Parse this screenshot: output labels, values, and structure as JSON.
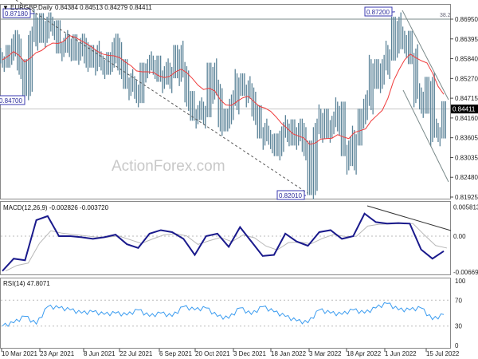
{
  "chart_data": [
    {
      "type": "bar",
      "title": "EURGBP,Daily",
      "ohlc_readout": "0.84384 0.84513 0.84279 0.84411",
      "price_axis_ticks": [
        "0.86950",
        "0.86395",
        "0.85840",
        "0.85270",
        "0.84715",
        "0.84160",
        "0.83605",
        "0.83035",
        "0.82480",
        "0.81925"
      ],
      "ylim": [
        0.8185,
        0.8738
      ],
      "current_price": "0.84411",
      "level_labels": [
        "0.87180",
        "0.84700",
        "0.87200",
        "0.82010"
      ],
      "fib_label": "38.2",
      "fib_level": 0.8695,
      "closes": [
        0.858,
        0.86,
        0.863,
        0.856,
        0.85,
        0.864,
        0.869,
        0.865,
        0.868,
        0.867,
        0.862,
        0.861,
        0.863,
        0.86,
        0.862,
        0.858,
        0.86,
        0.857,
        0.856,
        0.858,
        0.862,
        0.856,
        0.852,
        0.85,
        0.848,
        0.855,
        0.856,
        0.857,
        0.854,
        0.852,
        0.855,
        0.86,
        0.854,
        0.847,
        0.843,
        0.842,
        0.844,
        0.855,
        0.849,
        0.84,
        0.842,
        0.846,
        0.852,
        0.85,
        0.848,
        0.843,
        0.838,
        0.836,
        0.835,
        0.833,
        0.837,
        0.839,
        0.836,
        0.838,
        0.833,
        0.822,
        0.838,
        0.842,
        0.838,
        0.84,
        0.844,
        0.833,
        0.829,
        0.836,
        0.842,
        0.846,
        0.856,
        0.852,
        0.856,
        0.86,
        0.868,
        0.862,
        0.864,
        0.859,
        0.848,
        0.845,
        0.851,
        0.837,
        0.838,
        0.8441
      ],
      "colors": {
        "bars": "#5b8398",
        "ma": "#f03c3c",
        "trend": "#555555",
        "frame": "#888888"
      },
      "watermark": "ActionForex.com"
    },
    {
      "type": "line",
      "title": "MACD(12,26,9) -0.002826 -0.003720",
      "axis_ticks": [
        "0.005813",
        "0.00",
        "-0.006699"
      ],
      "ylim": [
        -0.0077,
        0.0066
      ],
      "macd": [
        -0.0065,
        -0.0042,
        -0.0045,
        0.0032,
        0.004,
        0.0,
        0.0,
        -0.0002,
        -0.0005,
        -0.0002,
        0.0003,
        -0.0015,
        -0.0022,
        0.0005,
        0.0012,
        0.0008,
        -0.0005,
        -0.0035,
        0.0,
        0.0005,
        -0.002,
        0.0018,
        -0.001,
        -0.0037,
        -0.0035,
        0.0005,
        -0.001,
        -0.0018,
        0.0008,
        0.0012,
        -0.0005,
        0.0,
        0.0045,
        0.0028,
        0.0025,
        0.0026,
        0.0025,
        -0.0025,
        -0.0042,
        -0.0028
      ],
      "colors": {
        "macd": "#1a1a8c",
        "signal": "#b8b8b8"
      }
    },
    {
      "type": "line",
      "title": "RSI(14) 47.8071",
      "axis_ticks": [
        "100",
        "70",
        "30",
        "0"
      ],
      "ylim": [
        0,
        100
      ],
      "rsi": [
        30,
        35,
        45,
        33,
        60,
        58,
        55,
        50,
        52,
        48,
        50,
        47,
        55,
        45,
        50,
        45,
        60,
        55,
        58,
        45,
        42,
        58,
        48,
        60,
        52,
        45,
        38,
        35,
        55,
        50,
        48,
        55,
        50,
        58,
        65,
        55,
        55,
        58,
        40,
        47.8
      ],
      "colors": {
        "rsi": "#3b9cf0"
      }
    }
  ],
  "x_axis_labels": [
    "10 Mar 2021",
    "23 Apr 2021",
    "8 Jun 2021",
    "22 Jul 2021",
    "6 Sep 2021",
    "20 Oct 2021",
    "3 Dec 2021",
    "18 Jan 2022",
    "3 Mar 2022",
    "18 Apr 2022",
    "1 Jun 2022",
    "15 Jul 2022"
  ]
}
